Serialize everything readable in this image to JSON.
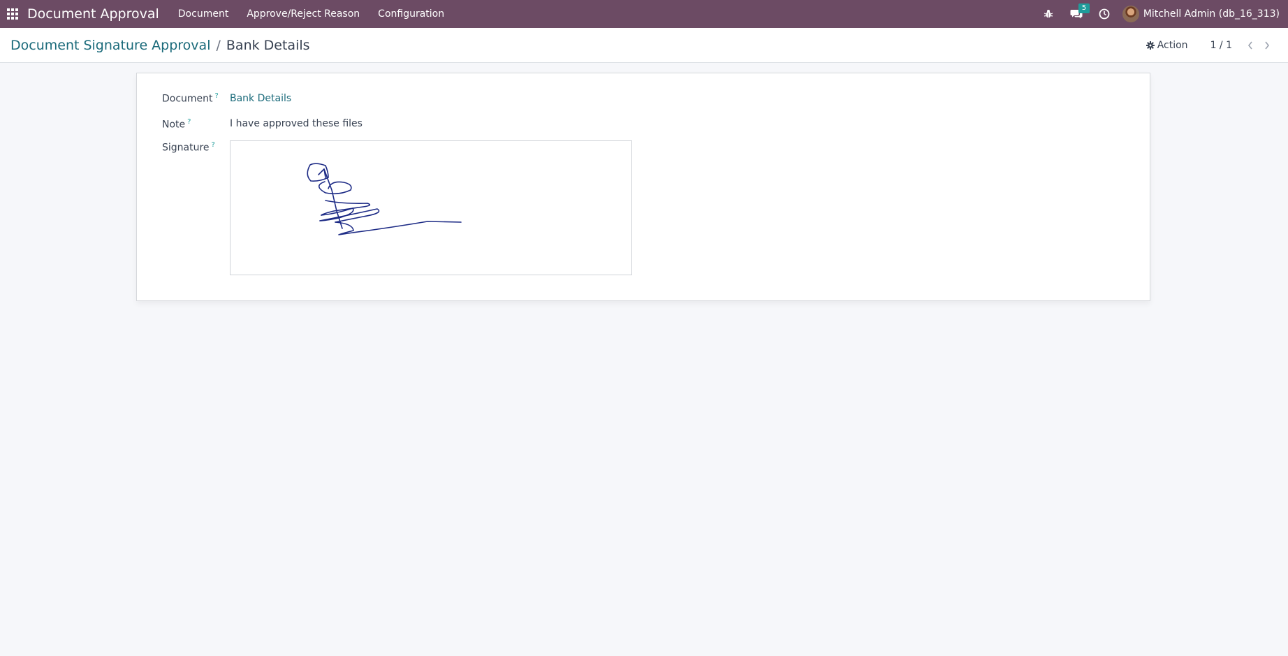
{
  "navbar": {
    "brand": "Document Approval",
    "menu": [
      "Document",
      "Approve/Reject Reason",
      "Configuration"
    ],
    "messages_badge": "5",
    "user": "Mitchell Admin (db_16_313)",
    "bg_color": "#6c4b64"
  },
  "breadcrumb": {
    "parent": "Document Signature Approval",
    "separator": "/",
    "current": "Bank Details"
  },
  "control": {
    "action_label": "Action",
    "pager": "1 / 1"
  },
  "form": {
    "document_label": "Document",
    "document_value": "Bank Details",
    "note_label": "Note",
    "note_value": "I have approved these files",
    "signature_label": "Signature",
    "help_mark": "?"
  },
  "icons": [
    "apps-grid-icon",
    "bug-icon",
    "chat-icon",
    "clock-icon",
    "gear-icon",
    "chevron-left-icon",
    "chevron-right-icon"
  ]
}
